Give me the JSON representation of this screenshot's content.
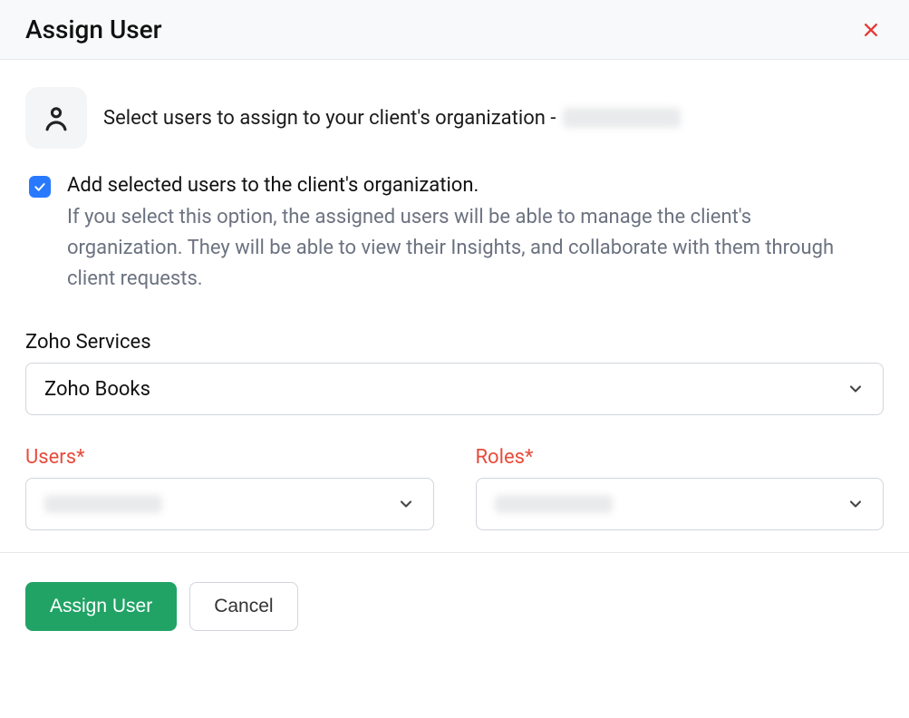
{
  "header": {
    "title": "Assign User"
  },
  "intro": {
    "text": "Select users to assign to your client's organization -"
  },
  "checkbox": {
    "label": "Add selected users to the client's organization.",
    "help": "If you select this option, the assigned users will be able to manage the client's organization. They will be able to view their Insights, and collaborate with them through client requests."
  },
  "services": {
    "label": "Zoho Services",
    "selected": "Zoho Books"
  },
  "users": {
    "label": "Users*"
  },
  "roles": {
    "label": "Roles*"
  },
  "footer": {
    "primary": "Assign User",
    "secondary": "Cancel"
  }
}
